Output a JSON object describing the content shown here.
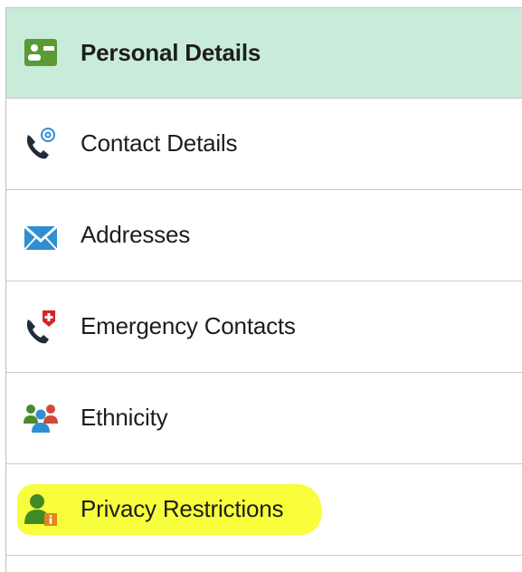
{
  "nav": {
    "items": [
      {
        "label": "Personal Details",
        "icon": "personal-card-icon",
        "active": true
      },
      {
        "label": "Contact Details",
        "icon": "phone-at-icon"
      },
      {
        "label": "Addresses",
        "icon": "envelope-icon"
      },
      {
        "label": "Emergency Contacts",
        "icon": "phone-medical-icon"
      },
      {
        "label": "Ethnicity",
        "icon": "people-group-icon"
      },
      {
        "label": "Privacy Restrictions",
        "icon": "person-info-icon",
        "highlighted": true
      }
    ]
  },
  "colors": {
    "active_bg": "#c9ebd9",
    "highlight": "#f8fd3c",
    "icon_green": "#4c8b2c",
    "icon_blue": "#2f8fd0"
  }
}
